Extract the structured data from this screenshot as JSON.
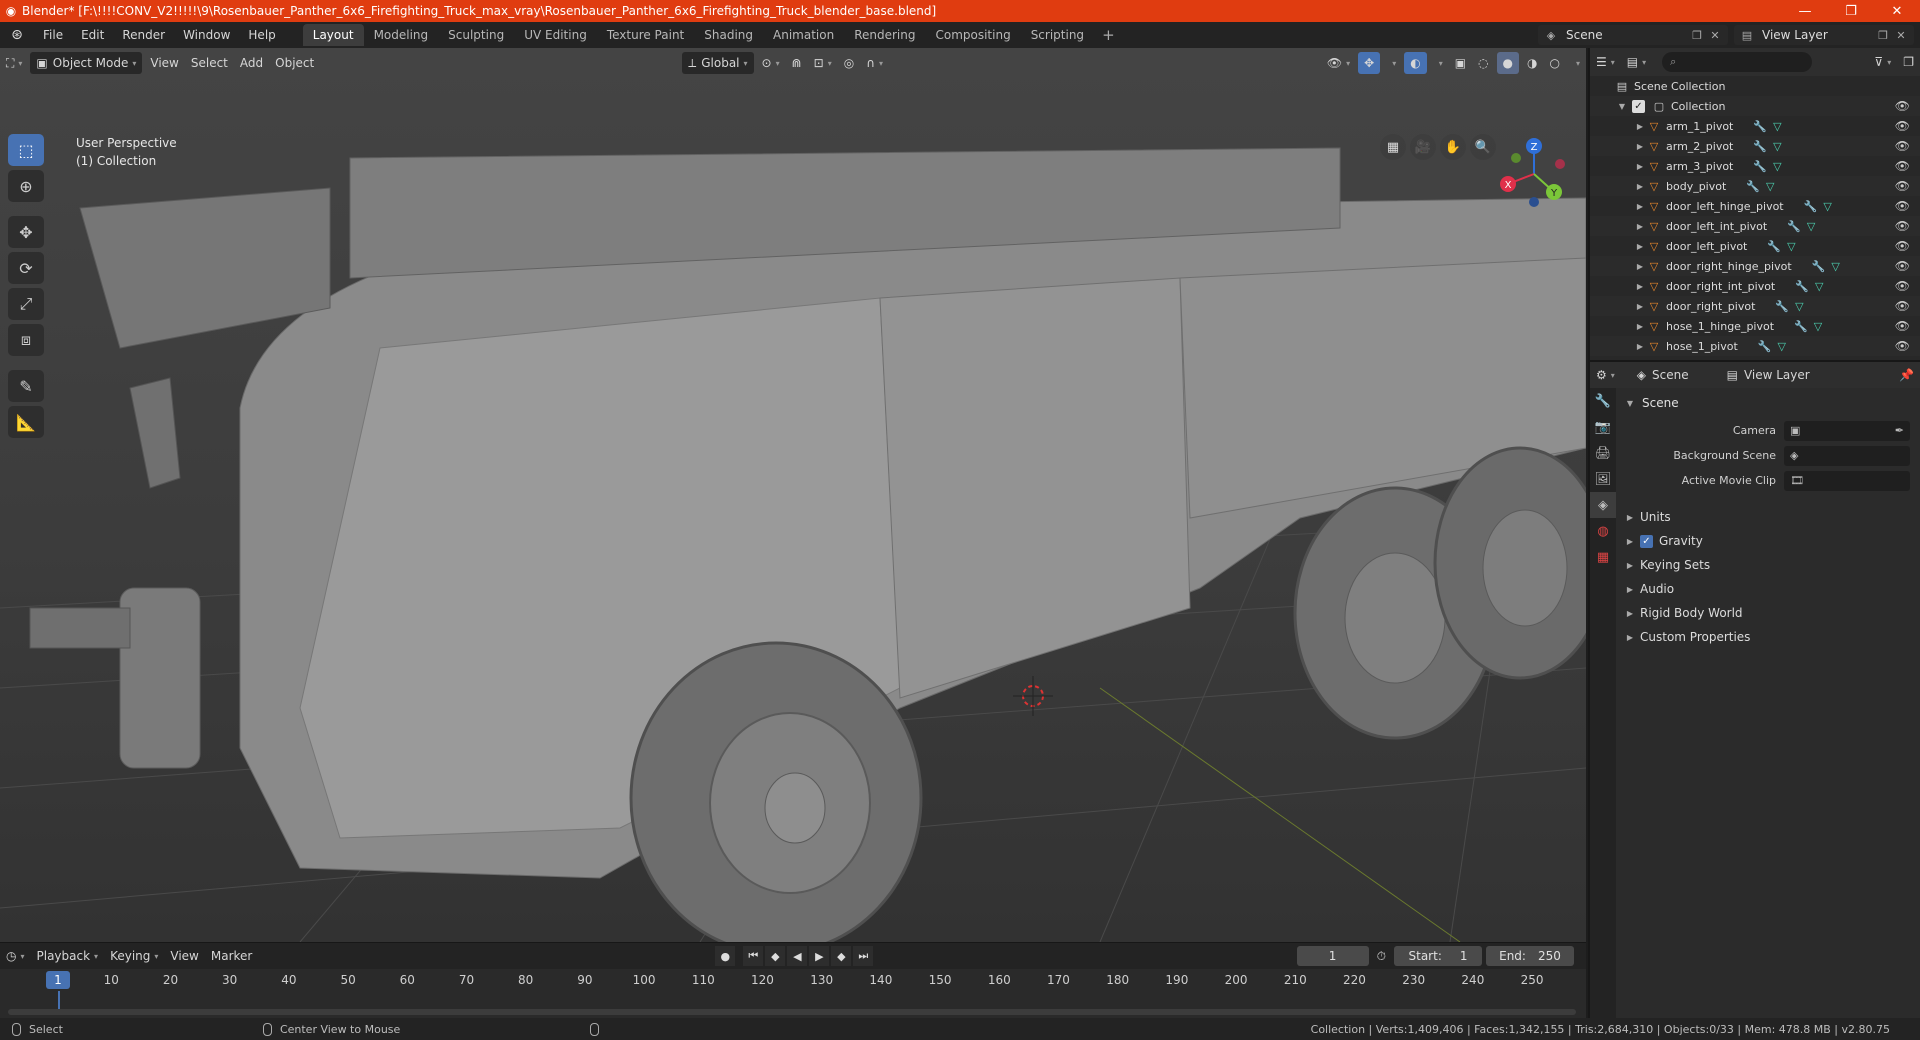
{
  "title_bar": {
    "title": "Blender* [F:\\!!!!CONV_V2!!!!!\\9\\Rosenbauer_Panther_6x6_Firefighting_Truck_max_vray\\Rosenbauer_Panther_6x6_Firefighting_Truck_blender_base.blend]",
    "minimize": "—",
    "maximize": "❐",
    "close": "✕"
  },
  "menu": {
    "items": [
      "File",
      "Edit",
      "Render",
      "Window",
      "Help"
    ],
    "workspaces": [
      "Layout",
      "Modeling",
      "Sculpting",
      "UV Editing",
      "Texture Paint",
      "Shading",
      "Animation",
      "Rendering",
      "Compositing",
      "Scripting"
    ],
    "active_workspace": "Layout",
    "scene_name": "Scene",
    "view_layer_name": "View Layer"
  },
  "viewport": {
    "mode": "Object Mode",
    "menus": [
      "View",
      "Select",
      "Add",
      "Object"
    ],
    "transform_orientation": "Global",
    "info_line1": "User Perspective",
    "info_line2": "(1) Collection",
    "gizmo": {
      "x": "X",
      "y": "Y",
      "z": "Z"
    }
  },
  "timeline": {
    "menus": [
      "Playback",
      "Keying",
      "View",
      "Marker"
    ],
    "current_frame": "1",
    "start_label": "Start:",
    "start": "1",
    "end_label": "End:",
    "end": "250",
    "frame_marks": [
      "1",
      "10",
      "20",
      "30",
      "40",
      "50",
      "60",
      "70",
      "80",
      "90",
      "100",
      "110",
      "120",
      "130",
      "140",
      "150",
      "160",
      "170",
      "180",
      "190",
      "200",
      "210",
      "220",
      "230",
      "240",
      "250"
    ]
  },
  "status_bar": {
    "left_action": "Select",
    "middle_action": "Center View to Mouse",
    "stats": "Collection | Verts:1,409,406 | Faces:1,342,155 | Tris:2,684,310 | Objects:0/33 | Mem: 478.8 MB | v2.80.75"
  },
  "outliner": {
    "root": "Scene Collection",
    "collection": "Collection",
    "objects": [
      "arm_1_pivot",
      "arm_2_pivot",
      "arm_3_pivot",
      "body_pivot",
      "door_left_hinge_pivot",
      "door_left_int_pivot",
      "door_left_pivot",
      "door_right_hinge_pivot",
      "door_right_int_pivot",
      "door_right_pivot",
      "hose_1_hinge_pivot",
      "hose_1_pivot"
    ]
  },
  "properties": {
    "header_scene": "Scene",
    "header_view_layer": "View Layer",
    "panel_title": "Scene",
    "fields": [
      {
        "label": "Camera",
        "value": ""
      },
      {
        "label": "Background Scene",
        "value": ""
      },
      {
        "label": "Active Movie Clip",
        "value": ""
      }
    ],
    "subpanels": [
      "Units",
      "Gravity",
      "Keying Sets",
      "Audio",
      "Rigid Body World",
      "Custom Properties"
    ]
  },
  "colors": {
    "title_bar": "#e03c10",
    "accent_blue": "#4772b3",
    "object_orange": "#e8872b",
    "mesh_teal": "#4cd0b0"
  }
}
